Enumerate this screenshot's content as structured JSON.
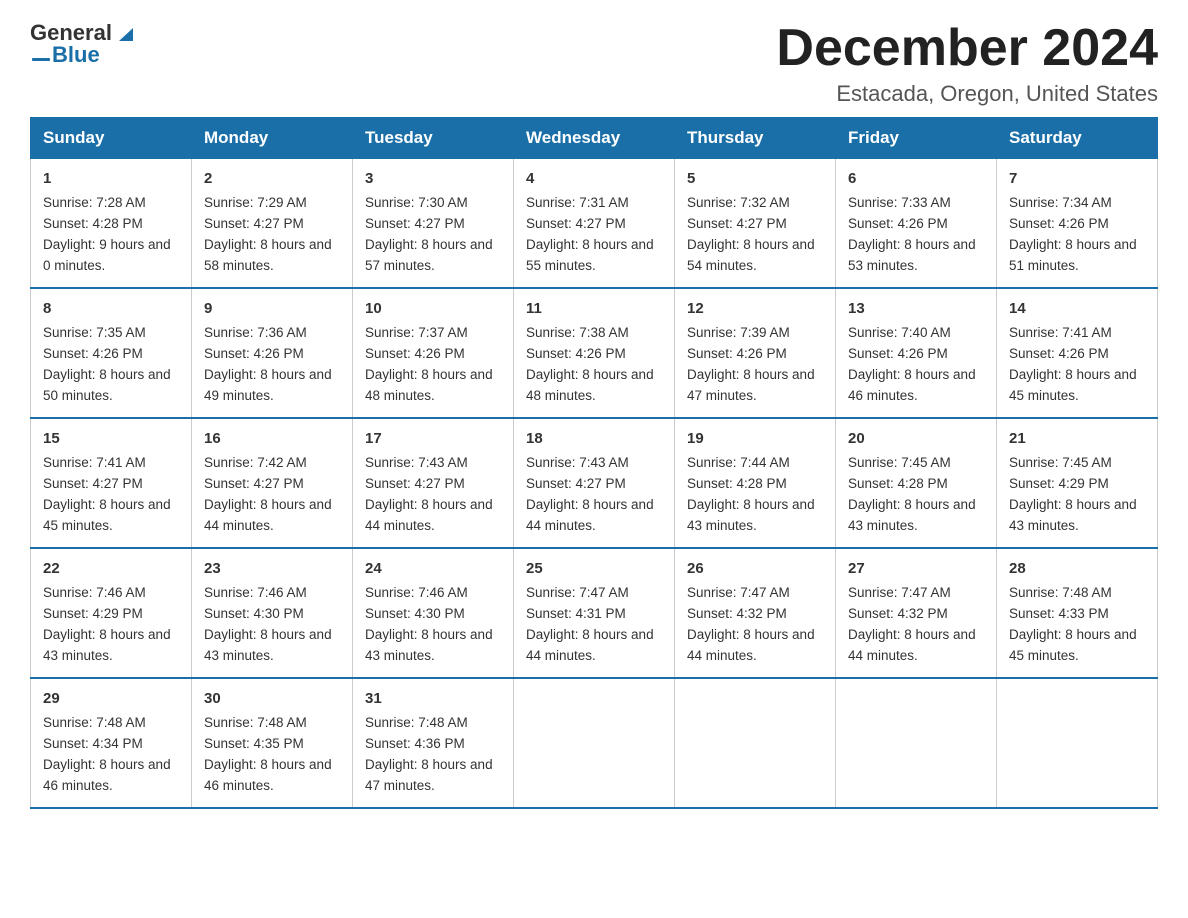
{
  "header": {
    "logo_general": "General",
    "logo_blue": "Blue",
    "month_title": "December 2024",
    "location": "Estacada, Oregon, United States"
  },
  "days_of_week": [
    "Sunday",
    "Monday",
    "Tuesday",
    "Wednesday",
    "Thursday",
    "Friday",
    "Saturday"
  ],
  "weeks": [
    [
      {
        "day": "1",
        "sunrise": "7:28 AM",
        "sunset": "4:28 PM",
        "daylight": "9 hours and 0 minutes."
      },
      {
        "day": "2",
        "sunrise": "7:29 AM",
        "sunset": "4:27 PM",
        "daylight": "8 hours and 58 minutes."
      },
      {
        "day": "3",
        "sunrise": "7:30 AM",
        "sunset": "4:27 PM",
        "daylight": "8 hours and 57 minutes."
      },
      {
        "day": "4",
        "sunrise": "7:31 AM",
        "sunset": "4:27 PM",
        "daylight": "8 hours and 55 minutes."
      },
      {
        "day": "5",
        "sunrise": "7:32 AM",
        "sunset": "4:27 PM",
        "daylight": "8 hours and 54 minutes."
      },
      {
        "day": "6",
        "sunrise": "7:33 AM",
        "sunset": "4:26 PM",
        "daylight": "8 hours and 53 minutes."
      },
      {
        "day": "7",
        "sunrise": "7:34 AM",
        "sunset": "4:26 PM",
        "daylight": "8 hours and 51 minutes."
      }
    ],
    [
      {
        "day": "8",
        "sunrise": "7:35 AM",
        "sunset": "4:26 PM",
        "daylight": "8 hours and 50 minutes."
      },
      {
        "day": "9",
        "sunrise": "7:36 AM",
        "sunset": "4:26 PM",
        "daylight": "8 hours and 49 minutes."
      },
      {
        "day": "10",
        "sunrise": "7:37 AM",
        "sunset": "4:26 PM",
        "daylight": "8 hours and 48 minutes."
      },
      {
        "day": "11",
        "sunrise": "7:38 AM",
        "sunset": "4:26 PM",
        "daylight": "8 hours and 48 minutes."
      },
      {
        "day": "12",
        "sunrise": "7:39 AM",
        "sunset": "4:26 PM",
        "daylight": "8 hours and 47 minutes."
      },
      {
        "day": "13",
        "sunrise": "7:40 AM",
        "sunset": "4:26 PM",
        "daylight": "8 hours and 46 minutes."
      },
      {
        "day": "14",
        "sunrise": "7:41 AM",
        "sunset": "4:26 PM",
        "daylight": "8 hours and 45 minutes."
      }
    ],
    [
      {
        "day": "15",
        "sunrise": "7:41 AM",
        "sunset": "4:27 PM",
        "daylight": "8 hours and 45 minutes."
      },
      {
        "day": "16",
        "sunrise": "7:42 AM",
        "sunset": "4:27 PM",
        "daylight": "8 hours and 44 minutes."
      },
      {
        "day": "17",
        "sunrise": "7:43 AM",
        "sunset": "4:27 PM",
        "daylight": "8 hours and 44 minutes."
      },
      {
        "day": "18",
        "sunrise": "7:43 AM",
        "sunset": "4:27 PM",
        "daylight": "8 hours and 44 minutes."
      },
      {
        "day": "19",
        "sunrise": "7:44 AM",
        "sunset": "4:28 PM",
        "daylight": "8 hours and 43 minutes."
      },
      {
        "day": "20",
        "sunrise": "7:45 AM",
        "sunset": "4:28 PM",
        "daylight": "8 hours and 43 minutes."
      },
      {
        "day": "21",
        "sunrise": "7:45 AM",
        "sunset": "4:29 PM",
        "daylight": "8 hours and 43 minutes."
      }
    ],
    [
      {
        "day": "22",
        "sunrise": "7:46 AM",
        "sunset": "4:29 PM",
        "daylight": "8 hours and 43 minutes."
      },
      {
        "day": "23",
        "sunrise": "7:46 AM",
        "sunset": "4:30 PM",
        "daylight": "8 hours and 43 minutes."
      },
      {
        "day": "24",
        "sunrise": "7:46 AM",
        "sunset": "4:30 PM",
        "daylight": "8 hours and 43 minutes."
      },
      {
        "day": "25",
        "sunrise": "7:47 AM",
        "sunset": "4:31 PM",
        "daylight": "8 hours and 44 minutes."
      },
      {
        "day": "26",
        "sunrise": "7:47 AM",
        "sunset": "4:32 PM",
        "daylight": "8 hours and 44 minutes."
      },
      {
        "day": "27",
        "sunrise": "7:47 AM",
        "sunset": "4:32 PM",
        "daylight": "8 hours and 44 minutes."
      },
      {
        "day": "28",
        "sunrise": "7:48 AM",
        "sunset": "4:33 PM",
        "daylight": "8 hours and 45 minutes."
      }
    ],
    [
      {
        "day": "29",
        "sunrise": "7:48 AM",
        "sunset": "4:34 PM",
        "daylight": "8 hours and 46 minutes."
      },
      {
        "day": "30",
        "sunrise": "7:48 AM",
        "sunset": "4:35 PM",
        "daylight": "8 hours and 46 minutes."
      },
      {
        "day": "31",
        "sunrise": "7:48 AM",
        "sunset": "4:36 PM",
        "daylight": "8 hours and 47 minutes."
      },
      null,
      null,
      null,
      null
    ]
  ],
  "labels": {
    "sunrise": "Sunrise:",
    "sunset": "Sunset:",
    "daylight": "Daylight:"
  }
}
